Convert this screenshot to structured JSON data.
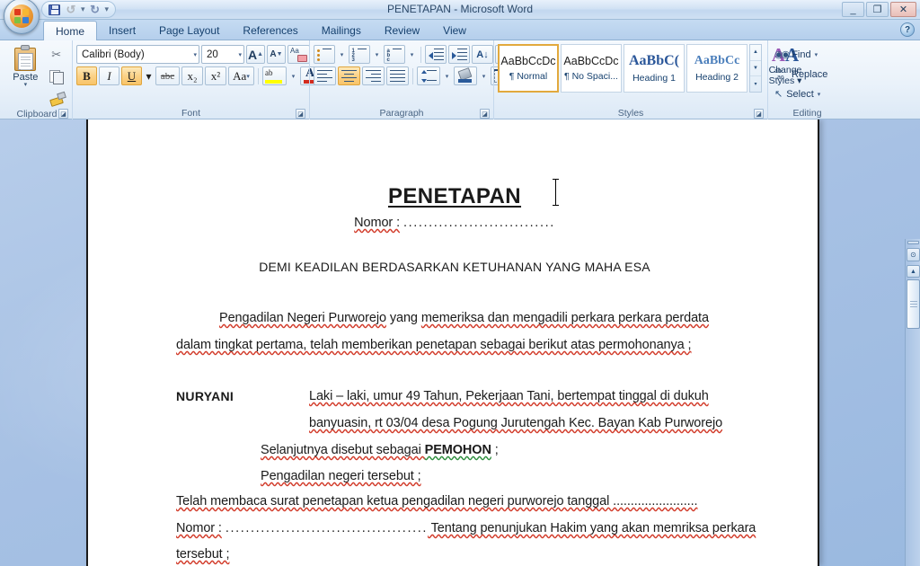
{
  "window": {
    "title": "PENETAPAN - Microsoft Word",
    "minimize": "_",
    "maximize": "❐",
    "close": "✕"
  },
  "quick_access": {
    "save": "save-icon",
    "undo": "↺",
    "undo_caret": "▾",
    "redo": "↻",
    "customize": "▾"
  },
  "office_button": "office-orb",
  "help": "?",
  "tabs": [
    {
      "label": "Home",
      "active": true
    },
    {
      "label": "Insert",
      "active": false
    },
    {
      "label": "Page Layout",
      "active": false
    },
    {
      "label": "References",
      "active": false
    },
    {
      "label": "Mailings",
      "active": false
    },
    {
      "label": "Review",
      "active": false
    },
    {
      "label": "View",
      "active": false
    }
  ],
  "ribbon": {
    "clipboard": {
      "label": "Clipboard",
      "paste": "Paste",
      "paste_caret": "▾",
      "cut": "✂",
      "copy": "copy-icon",
      "format_painter": "format-painter-icon",
      "dialog_launcher": "◪"
    },
    "font": {
      "label": "Font",
      "font_name": "Calibri (Body)",
      "font_size": "20",
      "caret": "▾",
      "grow_font": "A",
      "shrink_font": "A",
      "clear_formatting": "clear-formatting-icon",
      "bold": "B",
      "italic": "I",
      "underline": "U",
      "strikethrough": "abc",
      "subscript": "x₂",
      "superscript": "x²",
      "change_case": "Aa",
      "highlight": "ab",
      "font_color": "A",
      "dialog_launcher": "◪"
    },
    "paragraph": {
      "label": "Paragraph",
      "bullets": "bullet-list-icon",
      "numbering": "numbered-list-icon",
      "multilevel": "multilevel-list-icon",
      "decrease_indent": "decrease-indent-icon",
      "increase_indent": "increase-indent-icon",
      "sort": "A↓",
      "show_marks": "¶",
      "align_left": "align-left-icon",
      "align_center": "align-center-icon",
      "align_right": "align-right-icon",
      "justify": "justify-icon",
      "line_spacing": "line-spacing-icon",
      "shading": "shading-icon",
      "borders": "borders-icon",
      "caret": "▾",
      "dialog_launcher": "◪"
    },
    "styles": {
      "label": "Styles",
      "gallery": [
        {
          "preview": "AaBbCcDc",
          "name": "¶ Normal",
          "selected": true
        },
        {
          "preview": "AaBbCcDc",
          "name": "¶ No Spaci...",
          "selected": false
        },
        {
          "preview": "AaBbC(",
          "name": "Heading 1",
          "selected": false
        },
        {
          "preview": "AaBbCc",
          "name": "Heading 2",
          "selected": false
        }
      ],
      "scroll_up": "▲",
      "scroll_down": "▼",
      "more": "▾",
      "change_styles_line1": "Change",
      "change_styles_line2": "Styles ▾",
      "change_styles_icon_a1": "A",
      "change_styles_icon_a2": "A",
      "dialog_launcher": "◪"
    },
    "editing": {
      "label": "Editing",
      "find": "Find",
      "find_caret": "▾",
      "replace": "Replace",
      "select": "Select",
      "select_caret": "▾",
      "find_icon": "🔍",
      "select_icon": "↖"
    }
  },
  "document": {
    "title": "PENETAPAN",
    "nomor_label": "Nomor :",
    "nomor_dots": "..............................",
    "preamble": "DEMI KEADILAN BERDASARKAN KETUHANAN YANG MAHA ESA",
    "body_line_1a": "Pengadilan Negeri Purworejo",
    "body_line_1b": " yang ",
    "body_line_1c": "memeriksa dan mengadili perkara perkara perdata",
    "body_line_2": "dalam tingkat pertama, telah memberikan penetapan sebagai berikut atas permohonanya ;",
    "party_name": "NURYANI",
    "party_line_1": "Laki – laki, umur 49 Tahun, Pekerjaan Tani, bertempat tinggal di dukuh",
    "party_line_2": "banyuasin, rt 03/04 desa Pogung Jurutengah Kec. Bayan Kab Purworejo",
    "selanjutnya_pre": "Selanjutnya disebut sebagai ",
    "selanjutnya_bold": "PEMOHON",
    "selanjutnya_post": " ;",
    "pengadilan_tersebut": "Pengadilan negeri tersebut ;",
    "telah_membaca": "Telah membaca surat penetapan ketua pengadilan negeri purworejo tanggal ........................",
    "nomor2_label": "Nomor :",
    "nomor2_dots": "........................................",
    "nomor2_rest": " Tentang penunjukan Hakim yang akan memriksa perkara",
    "tersebut": "tersebut ;"
  },
  "scrollbar": {
    "split": "split-bar",
    "browse_object": "⊙",
    "up_arrow": "▲"
  },
  "colors": {
    "accent": "#2a5699",
    "highlight_yellow": "#ffff00",
    "font_color_red": "#d32b1e",
    "spelling_red": "#d23b2a",
    "grammar_green": "#2f8f3f",
    "selected_gold": "#e2a93d"
  }
}
